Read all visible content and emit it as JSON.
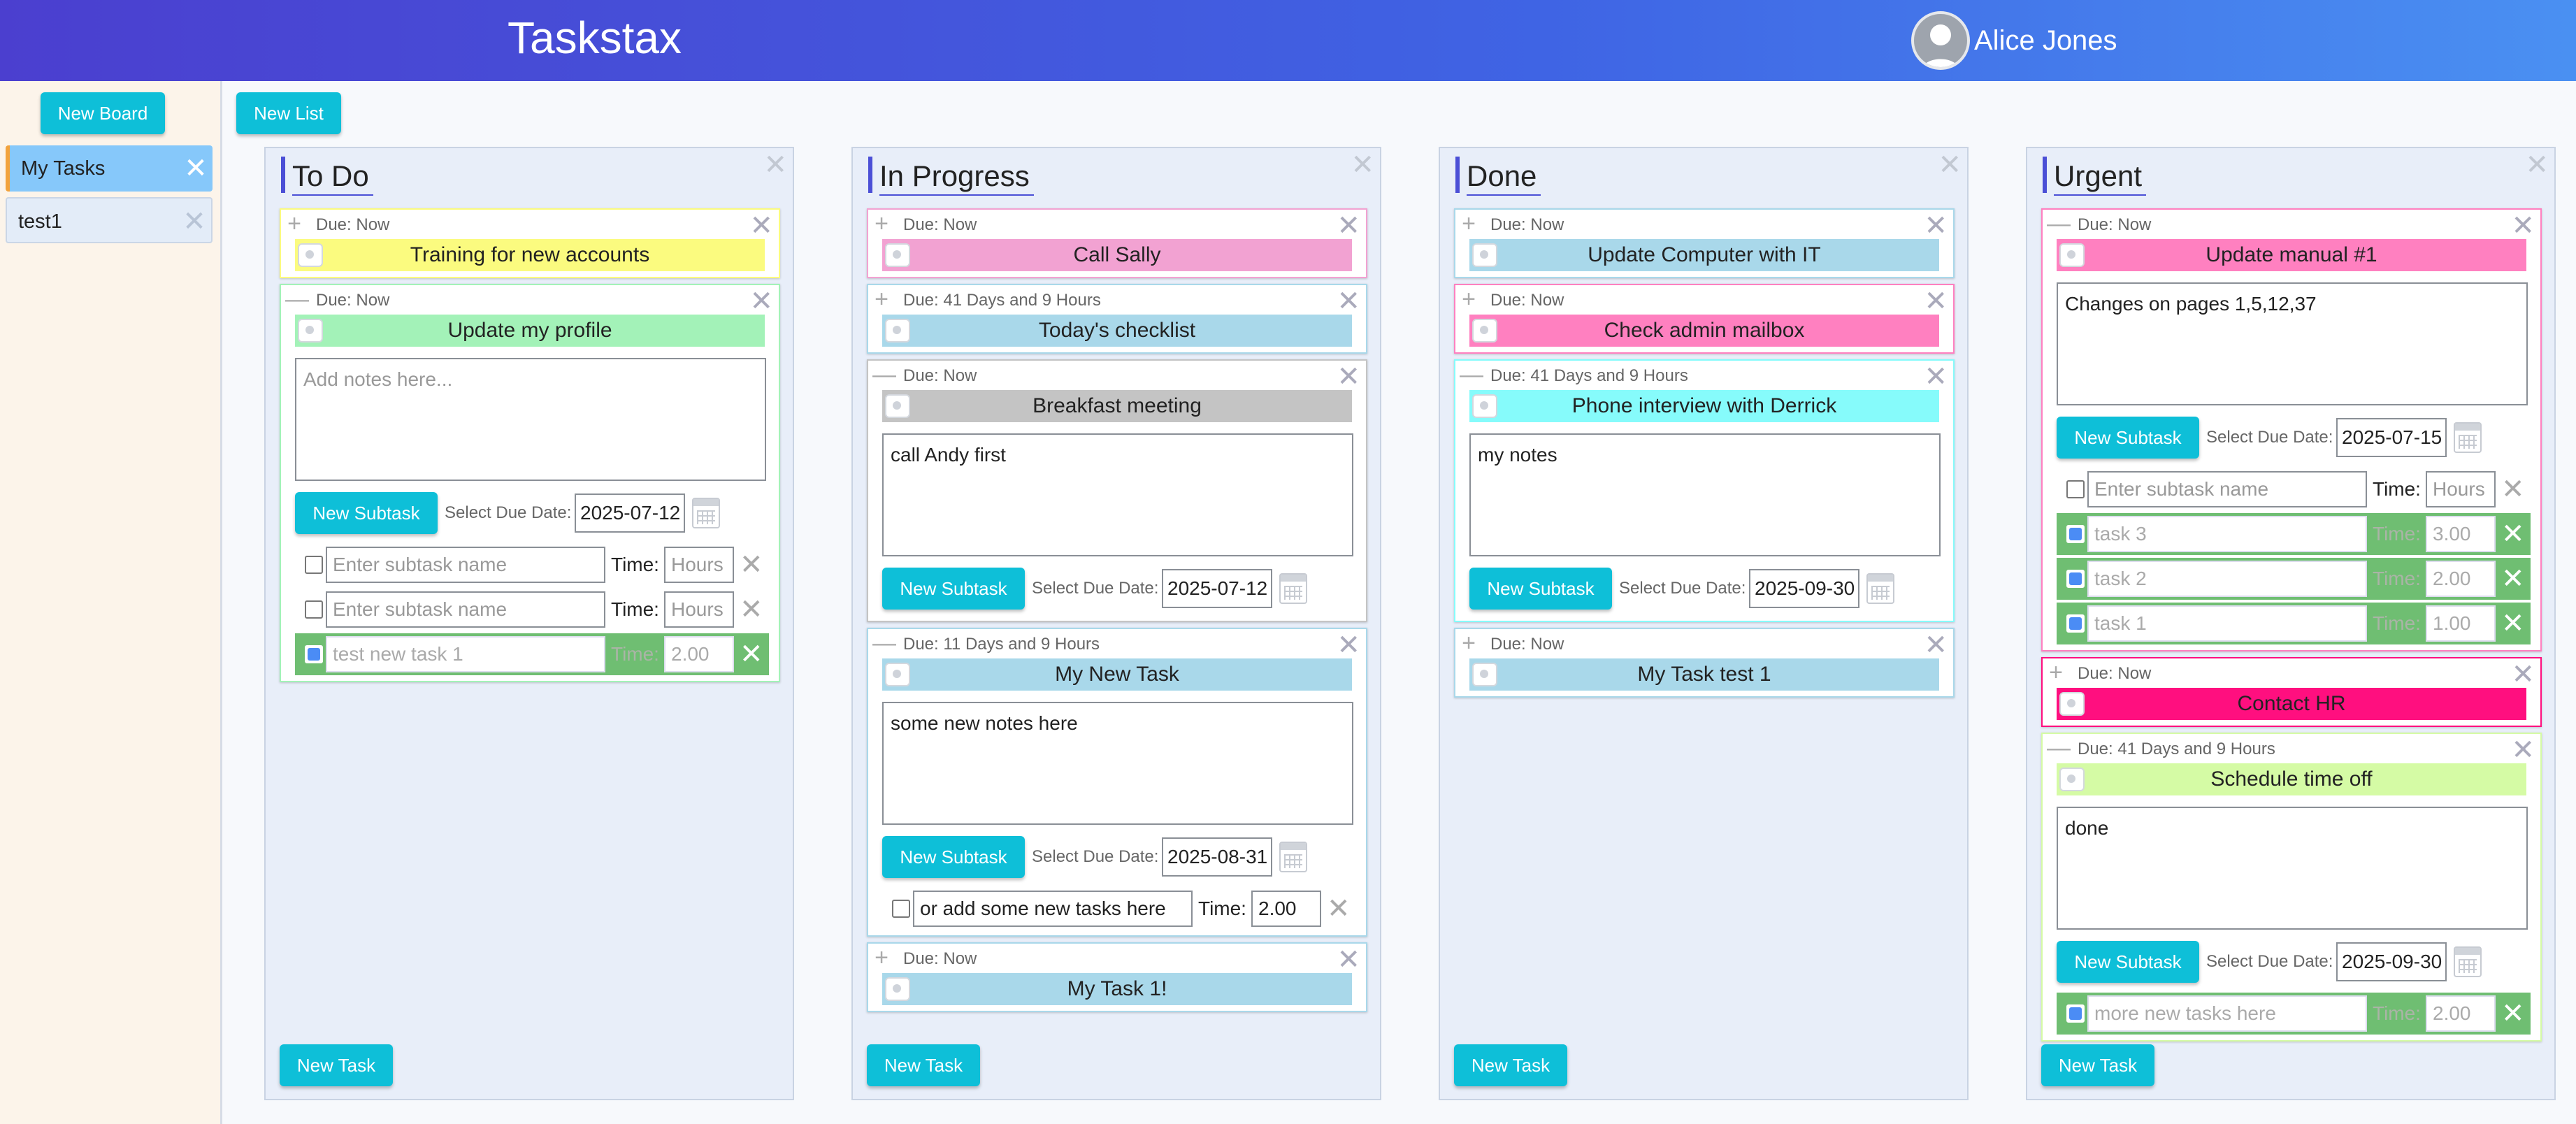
{
  "header": {
    "app_title": "Taskstax",
    "user_name": "Alice Jones",
    "gradient_start": "#4b3fcf",
    "gradient_end": "#4a90f2"
  },
  "sidebar": {
    "new_board_label": "New Board",
    "boards": [
      {
        "name": "My Tasks",
        "selected": true
      },
      {
        "name": "test1",
        "selected": false
      }
    ]
  },
  "toolbar": {
    "new_list_label": "New List"
  },
  "strings": {
    "close_glyph": "✕",
    "expand_glyph": "+",
    "collapse_glyph": "—",
    "new_task_label": "New Task",
    "new_subtask_label": "New Subtask",
    "select_due_label": "Select Due Date:",
    "time_label": "Time:",
    "notes_placeholder": "Add notes here...",
    "subtask_placeholder": "Enter subtask name",
    "hours_placeholder": "Hours"
  },
  "lists": [
    {
      "title": "To Do",
      "cards": [
        {
          "due": "Due: Now",
          "title": "Training for new accounts",
          "color": "#fbfb7f",
          "expanded": false
        },
        {
          "due": "Due: Now",
          "title": "Update my profile",
          "color": "#a3f2b8",
          "expanded": true,
          "notes": "",
          "due_date": "2025-07-12",
          "subtasks": [
            {
              "name": "",
              "time": "",
              "done": false
            },
            {
              "name": "",
              "time": "",
              "done": false
            },
            {
              "name": "test new task 1",
              "time": "2.00",
              "done": true
            }
          ]
        }
      ]
    },
    {
      "title": "In Progress",
      "cards": [
        {
          "due": "Due: Now",
          "title": "Call Sally",
          "color": "#f2a2d2",
          "expanded": false
        },
        {
          "due": "Due: 41 Days and 9 Hours",
          "title": "Today's checklist",
          "color": "#a9d8ea",
          "expanded": false
        },
        {
          "due": "Due: Now",
          "title": "Breakfast meeting",
          "color": "#c4c4c4",
          "expanded": true,
          "notes": "call Andy first",
          "due_date": "2025-07-12",
          "subtasks": []
        },
        {
          "due": "Due: 11 Days and 9 Hours",
          "title": "My New Task",
          "color": "#a9d8ea",
          "expanded": true,
          "notes": "some new notes here",
          "due_date": "2025-08-31",
          "subtasks": [
            {
              "name": "or add some new tasks here",
              "time": "2.00",
              "done": false
            }
          ]
        },
        {
          "due": "Due: Now",
          "title": "My Task 1!",
          "color": "#a9d8ea",
          "expanded": false
        }
      ]
    },
    {
      "title": "Done",
      "cards": [
        {
          "due": "Due: Now",
          "title": "Update Computer with IT",
          "color": "#a9d8ea",
          "expanded": false
        },
        {
          "due": "Due: Now",
          "title": "Check admin mailbox",
          "color": "#ff80c0",
          "expanded": false
        },
        {
          "due": "Due: 41 Days and 9 Hours",
          "title": "Phone interview with Derrick",
          "color": "#86fbfb",
          "expanded": true,
          "notes": "my notes",
          "due_date": "2025-09-30",
          "subtasks": []
        },
        {
          "due": "Due: Now",
          "title": "My Task test 1",
          "color": "#a9d8ea",
          "expanded": false
        }
      ]
    },
    {
      "title": "Urgent",
      "cards": [
        {
          "due": "Due: Now",
          "title": "Update manual #1",
          "color": "#ff80c0",
          "expanded": true,
          "notes": "Changes on pages 1,5,12,37",
          "due_date": "2025-07-15",
          "subtasks": [
            {
              "name": "",
              "time": "",
              "done": false
            },
            {
              "name": "task 3",
              "time": "3.00",
              "done": true
            },
            {
              "name": "task 2",
              "time": "2.00",
              "done": true
            },
            {
              "name": "task 1",
              "time": "1.00",
              "done": true
            }
          ]
        },
        {
          "due": "Due: Now",
          "title": "Contact HR",
          "color": "#ff0f7f",
          "expanded": false
        },
        {
          "due": "Due: 41 Days and 9 Hours",
          "title": "Schedule time off",
          "color": "#d5fba5",
          "expanded": true,
          "notes": "done",
          "due_date": "2025-09-30",
          "subtasks": [
            {
              "name": "more new tasks here",
              "time": "2.00",
              "done": true
            }
          ]
        }
      ]
    }
  ]
}
